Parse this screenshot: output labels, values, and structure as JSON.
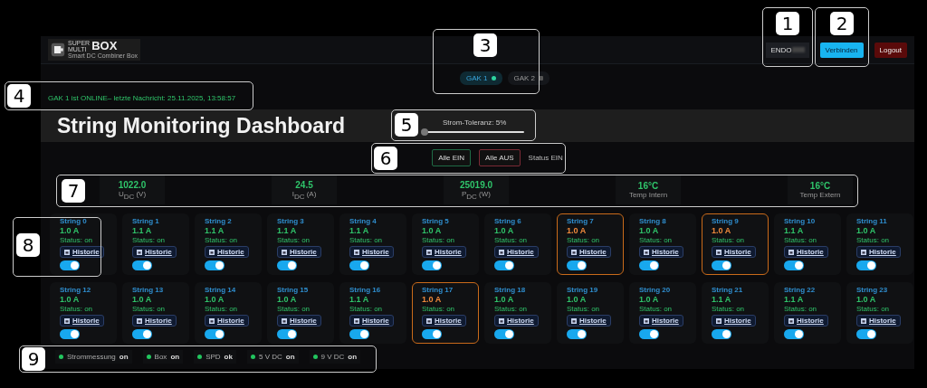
{
  "header": {
    "logo_small_top": "SUPER",
    "logo_small_bottom": "MULTI",
    "logo_big": "BOX",
    "logo_subtitle": "Smart DC Combiner Box",
    "device_field": {
      "value": "ENDO"
    },
    "connect_button": "Verbinden",
    "logout_button": "Logout"
  },
  "tabs": [
    {
      "label": "GAK 1",
      "selected": true,
      "online": true
    },
    {
      "label": "GAK 2",
      "selected": false,
      "online": false
    }
  ],
  "status_message": "GAK 1 ist ONLINE– letzte Nachricht: 25.11.2025, 13:58:57",
  "title": "String Monitoring Dashboard",
  "tolerance": {
    "label": "Strom-Toleranz: 5%",
    "level": 0.0
  },
  "controls": {
    "all_on": "Alle EIN",
    "all_off": "Alle AUS",
    "status": "Status EIN"
  },
  "metrics": [
    {
      "value": "1022.0",
      "label": "U$_{DC}$ (V)"
    },
    {
      "value": "24.5",
      "label": "I$_{DC}$ (A)"
    },
    {
      "value": "25019.0",
      "label": "P$_{DC}$ (W)"
    },
    {
      "value": "16°C",
      "label": "Temp Intern"
    },
    {
      "value": "16°C",
      "label": "Temp Extern"
    }
  ],
  "strings": [
    {
      "name": "String 0",
      "current": "1.0 A",
      "alert": false,
      "status": "Status: on",
      "history": "Historie",
      "on": true
    },
    {
      "name": "String 1",
      "current": "1.1 A",
      "alert": false,
      "status": "Status: on",
      "history": "Historie",
      "on": true
    },
    {
      "name": "String 2",
      "current": "1.1 A",
      "alert": false,
      "status": "Status: on",
      "history": "Historie",
      "on": true
    },
    {
      "name": "String 3",
      "current": "1.1 A",
      "alert": false,
      "status": "Status: on",
      "history": "Historie",
      "on": true
    },
    {
      "name": "String 4",
      "current": "1.1 A",
      "alert": false,
      "status": "Status: on",
      "history": "Historie",
      "on": true
    },
    {
      "name": "String 5",
      "current": "1.0 A",
      "alert": false,
      "status": "Status: on",
      "history": "Historie",
      "on": true
    },
    {
      "name": "String 6",
      "current": "1.0 A",
      "alert": false,
      "status": "Status: on",
      "history": "Historie",
      "on": true
    },
    {
      "name": "String 7",
      "current": "1.0 A",
      "alert": true,
      "status": "Status: on",
      "history": "Historie",
      "on": true
    },
    {
      "name": "String 8",
      "current": "1.0 A",
      "alert": false,
      "status": "Status: on",
      "history": "Historie",
      "on": true
    },
    {
      "name": "String 9",
      "current": "1.0 A",
      "alert": true,
      "status": "Status: on",
      "history": "Historie",
      "on": true
    },
    {
      "name": "String 10",
      "current": "1.1 A",
      "alert": false,
      "status": "Status: on",
      "history": "Historie",
      "on": true
    },
    {
      "name": "String 11",
      "current": "1.0 A",
      "alert": false,
      "status": "Status: on",
      "history": "Historie",
      "on": true
    },
    {
      "name": "String 12",
      "current": "1.0 A",
      "alert": false,
      "status": "Status: on",
      "history": "Historie",
      "on": true
    },
    {
      "name": "String 13",
      "current": "1.0 A",
      "alert": false,
      "status": "Status: on",
      "history": "Historie",
      "on": true
    },
    {
      "name": "String 14",
      "current": "1.0 A",
      "alert": false,
      "status": "Status: on",
      "history": "Historie",
      "on": true
    },
    {
      "name": "String 15",
      "current": "1.0 A",
      "alert": false,
      "status": "Status: on",
      "history": "Historie",
      "on": true
    },
    {
      "name": "String 16",
      "current": "1.1 A",
      "alert": false,
      "status": "Status: on",
      "history": "Historie",
      "on": true
    },
    {
      "name": "String 17",
      "current": "1.0 A",
      "alert": true,
      "status": "Status: on",
      "history": "Historie",
      "on": true
    },
    {
      "name": "String 18",
      "current": "1.0 A",
      "alert": false,
      "status": "Status: on",
      "history": "Historie",
      "on": true
    },
    {
      "name": "String 19",
      "current": "1.0 A",
      "alert": false,
      "status": "Status: on",
      "history": "Historie",
      "on": true
    },
    {
      "name": "String 20",
      "current": "1.0 A",
      "alert": false,
      "status": "Status: on",
      "history": "Historie",
      "on": true
    },
    {
      "name": "String 21",
      "current": "1.1 A",
      "alert": false,
      "status": "Status: on",
      "history": "Historie",
      "on": true
    },
    {
      "name": "String 22",
      "current": "1.1 A",
      "alert": false,
      "status": "Status: on",
      "history": "Historie",
      "on": true
    },
    {
      "name": "String 23",
      "current": "1.0 A",
      "alert": false,
      "status": "Status: on",
      "history": "Historie",
      "on": true
    }
  ],
  "status_bar": [
    {
      "label": "Strommessung",
      "value": "on",
      "color": "#22c55e"
    },
    {
      "label": "Box",
      "value": "on",
      "color": "#22c55e"
    },
    {
      "label": "SPD",
      "value": "ok",
      "color": "#22c55e"
    },
    {
      "label": "5 V DC",
      "value": "on",
      "color": "#22c55e"
    },
    {
      "label": "9 V DC",
      "value": "on",
      "color": "#22c55e"
    }
  ],
  "callouts": [
    {
      "label": "1"
    },
    {
      "label": "2"
    },
    {
      "label": "3"
    },
    {
      "label": "4"
    },
    {
      "label": "5"
    },
    {
      "label": "6"
    },
    {
      "label": "7"
    },
    {
      "label": "8"
    },
    {
      "label": "9"
    }
  ]
}
